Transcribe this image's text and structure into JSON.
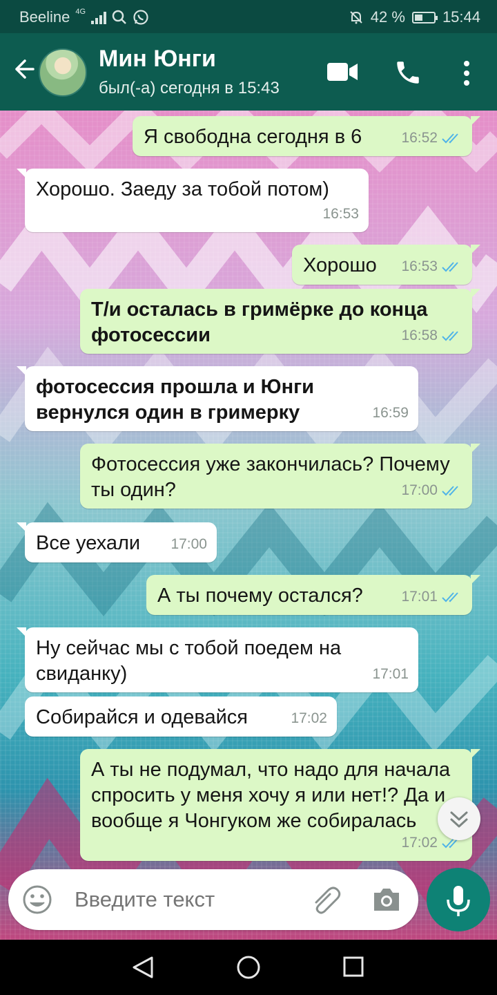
{
  "status_bar": {
    "carrier": "Beeline",
    "network": "4G",
    "battery": "42 %",
    "battery_level": 0.42,
    "time": "15:44"
  },
  "header": {
    "contact_name": "Мин Юнги",
    "last_seen": "был(-а) сегодня в 15:43",
    "icons": [
      "back-arrow-icon",
      "video-call-icon",
      "phone-icon",
      "more-vert-icon"
    ]
  },
  "messages": [
    {
      "dir": "out",
      "text": "Я свободна сегодня в 6",
      "time": "16:52",
      "bold": false
    },
    {
      "dir": "in",
      "text": "Хорошо. Заеду за тобой потом)",
      "time": "16:53",
      "bold": false
    },
    {
      "dir": "out",
      "text": "Хорошо",
      "time": "16:53",
      "bold": false
    },
    {
      "dir": "out",
      "text": "Т/и осталась в гримёрке до конца фотосессии",
      "time": "16:58",
      "bold": true
    },
    {
      "dir": "in",
      "text": "фотосессия прошла и Юнги вернулся один в гримерку",
      "time": "16:59",
      "bold": true
    },
    {
      "dir": "out",
      "text": "Фотосессия уже закончилась? Почему ты один?",
      "time": "17:00",
      "bold": false
    },
    {
      "dir": "in",
      "text": "Все уехали",
      "time": "17:00",
      "bold": false
    },
    {
      "dir": "out",
      "text": "А ты почему остался?",
      "time": "17:01",
      "bold": false
    },
    {
      "dir": "in",
      "text": "Ну сейчас мы с тобой поедем на свиданку)",
      "time": "17:01",
      "bold": false
    },
    {
      "dir": "in",
      "text": "Собирайся и одевайся",
      "time": "17:02",
      "bold": false
    },
    {
      "dir": "out",
      "text": "А ты не подумал, что надо для начала спросить у меня хочу я или нет!? Да и вообще я Чонгуком же собиралась",
      "time": "17:02",
      "bold": false
    }
  ],
  "composer": {
    "placeholder": "Введите текст",
    "icons": [
      "emoji-icon",
      "attach-icon",
      "camera-icon",
      "mic-icon"
    ]
  },
  "colors": {
    "header": "#0d5c50",
    "outgoing_bubble": "#dcf8c6",
    "incoming_bubble": "#ffffff",
    "read_ticks": "#4fb3e8",
    "mic_button": "#0e8275"
  }
}
